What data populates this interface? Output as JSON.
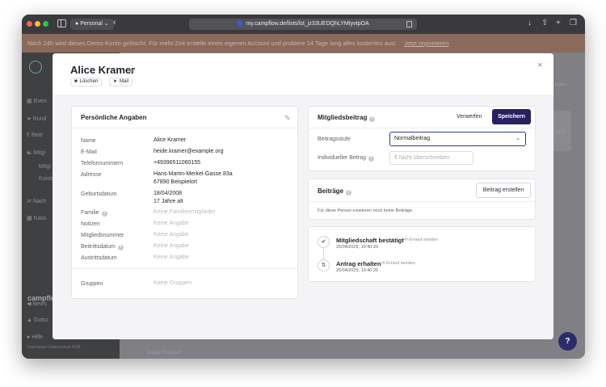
{
  "browser": {
    "profile": "Personal",
    "url": "my.campflow.de/lists/lst_jz33UEDQhLYMtyvtpOA"
  },
  "banner": {
    "text": "Nach 24h wird dieses Demo-Konto gelöscht. Für mehr Zeit erstelle einen eigenen Account und probiere 14 Tage lang alles kostenlos aus!",
    "link": "Jetzt registrieren"
  },
  "sidebar": {
    "items": [
      "Even",
      "Rund",
      "Beitr",
      "Mitgl",
      "Mitgl",
      "Konta",
      "Nach",
      "Kass",
      "News",
      "Gutsc",
      "Hilfe"
    ],
    "brand": "campflow",
    "footer": "Impressum   Datenschutz   AGB"
  },
  "background": {
    "fragment_right": "ungen",
    "fragment_der": "DER",
    "fragment_bottom": "Drittal Friedrich"
  },
  "modal": {
    "title": "Alice Kramer",
    "delete_label": "Löschen",
    "mail_label": "Mail",
    "close_symbol": "×"
  },
  "personal": {
    "title": "Persönliche Angaben",
    "rows": [
      {
        "label": "Name",
        "value": "Alice Kramer"
      },
      {
        "label": "E-Mail",
        "value": "heide.kramer@example.org"
      },
      {
        "label": "Telefonnummern",
        "value": "+49396511060155"
      },
      {
        "label": "Adresse",
        "value": "Hans-Martin-Merkel-Gasse 83a",
        "value2": "67890 Beispielort"
      },
      {
        "label": "Geburtsdatum",
        "value": "18/04/2008",
        "value2": "17 Jahre alt"
      },
      {
        "label": "Familie",
        "value": "Keine Familienmitglieder"
      },
      {
        "label": "Notizen",
        "value": "Keine Angabe"
      },
      {
        "label": "Mitgliedsnummer",
        "value": "Keine Angabe"
      },
      {
        "label": "Beitrittsdatum",
        "value": "Keine Angabe"
      },
      {
        "label": "Austrittsdatum",
        "value": "Keine Angabe"
      },
      {
        "label": "Gruppen",
        "value": "Keine Gruppen"
      }
    ]
  },
  "membership_fee": {
    "title": "Mitgliedsbeitrag",
    "discard_label": "Verwerfen",
    "save_label": "Speichern",
    "tier_label": "Beitragsstufe",
    "tier_value": "Normalbeitrag",
    "individual_label": "Individueller Betrag",
    "individual_currency": "€",
    "individual_placeholder": "Nicht überschreiben"
  },
  "contributions": {
    "title": "Beiträge",
    "create_label": "Beitrag erstellen",
    "empty_text": "Für diese Person existieren noch keine Beiträge."
  },
  "timeline": [
    {
      "title": "Mitgliedschaft bestätigt",
      "resend": "Erneut senden",
      "time": "25/04/2025, 10:40:20"
    },
    {
      "title": "Antrag erhalten",
      "resend": "Erneut senden",
      "time": "25/04/2025, 10:40:20"
    }
  ],
  "colors": {
    "primary": "#262262",
    "banner": "#8a6a5a"
  }
}
